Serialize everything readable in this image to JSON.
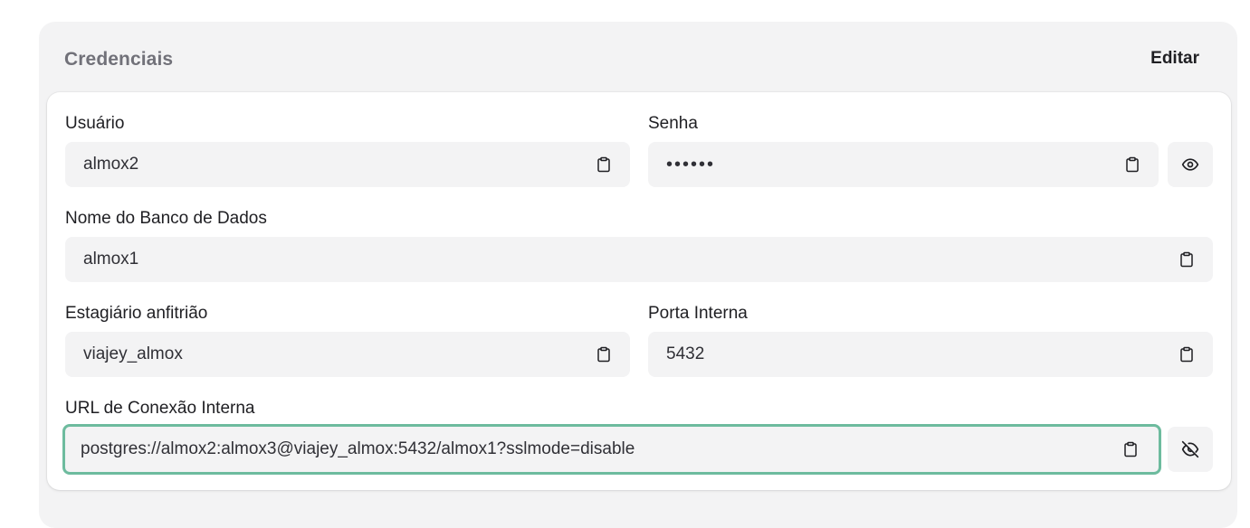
{
  "card": {
    "title": "Credenciais",
    "edit_label": "Editar"
  },
  "fields": {
    "user": {
      "label": "Usuário",
      "value": "almox2"
    },
    "password": {
      "label": "Senha",
      "value": "••••••"
    },
    "database": {
      "label": "Nome do Banco de Dados",
      "value": "almox1"
    },
    "host": {
      "label": "Estagiário anfitrião",
      "value": "viajey_almox"
    },
    "port": {
      "label": "Porta Interna",
      "value": "5432"
    },
    "url": {
      "label": "URL de Conexão Interna",
      "value": "postgres://almox2:almox3@viajey_almox:5432/almox1?sslmode=disable"
    }
  },
  "icons": {
    "copy": "clipboard-icon",
    "show_password": "eye-icon",
    "hide_url": "eye-off-icon"
  },
  "colors": {
    "focus_ring": "#6dbb9e",
    "field_bg": "#f3f3f4",
    "title_muted": "#717179"
  }
}
